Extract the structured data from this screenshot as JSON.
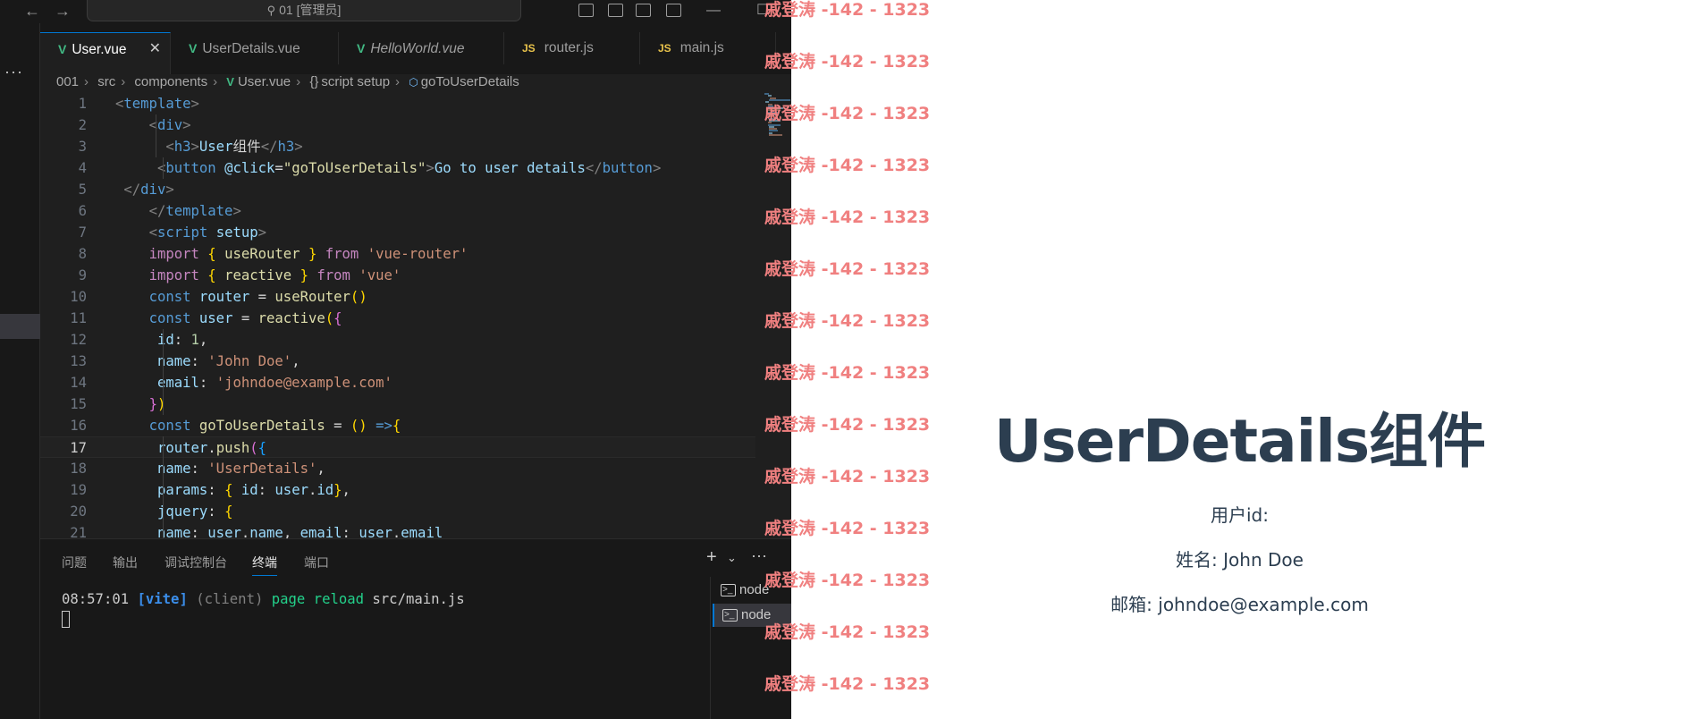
{
  "editor": {
    "command_center": "01 [管理员]",
    "tabs": [
      {
        "label": "User.vue",
        "icon": "vue-icon",
        "active": true
      },
      {
        "label": "UserDetails.vue",
        "icon": "vue-icon"
      },
      {
        "label": "HelloWorld.vue",
        "icon": "vue-icon",
        "italic": true
      },
      {
        "label": "router.js",
        "icon": "js-icon",
        "icon_text": "JS"
      },
      {
        "label": "main.js",
        "icon": "js-icon",
        "icon_text": "JS"
      }
    ],
    "breadcrumb": [
      "001",
      "src",
      "components",
      "User.vue",
      "script setup",
      "goToUserDetails"
    ],
    "current_line": 17,
    "line_numbers": [
      "1",
      "2",
      "3",
      "4",
      "5",
      "6",
      "7",
      "8",
      "9",
      "10",
      "11",
      "12",
      "13",
      "14",
      "15",
      "16",
      "17",
      "18",
      "19",
      "20",
      "21"
    ],
    "code_lines": [
      "<template>",
      "    <div>",
      "      <h3>User组件</h3>",
      "     <button @click=\"goToUserDetails\">Go to user details</button>",
      " </div>",
      "    </template>",
      "    <script setup>",
      "    import { useRouter } from 'vue-router'",
      "    import { reactive } from 'vue'",
      "    const router = useRouter()",
      "    const user = reactive({",
      "     id: 1,",
      "     name: 'John Doe',",
      "     email: 'johndoe@example.com'",
      "    })",
      "    const goToUserDetails = () =>{",
      "     router.push({",
      "     name: 'UserDetails',",
      "     params: { id: user.id},",
      "     jquery: {",
      "     name: user.name, email: user.email"
    ]
  },
  "panel": {
    "tabs": [
      "问题",
      "输出",
      "调试控制台",
      "终端",
      "端口"
    ],
    "active_tab": "终端",
    "terminal": {
      "time": "08:57:01",
      "tag": "[vite]",
      "client": "(client)",
      "action": "page reload",
      "file": "src/main.js"
    },
    "terminal_instances": [
      "node",
      "node"
    ]
  },
  "preview": {
    "title": "UserDetails组件",
    "user_id": "用户id:",
    "name": "姓名: John Doe",
    "email": "邮箱: johndoe@example.com"
  },
  "watermark": {
    "text": "戚登涛 -142 - 1323",
    "count": 14
  },
  "colors": {
    "editor_bg": "#1f1f1f",
    "accent": "#0078d4",
    "preview_title": "#2c3e50",
    "watermark": "#f08080"
  }
}
